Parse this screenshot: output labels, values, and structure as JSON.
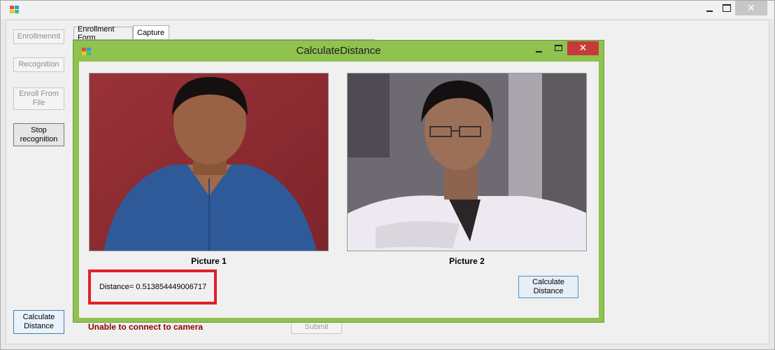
{
  "main_window": {
    "tabs": [
      {
        "label": "Enrollment Form",
        "active": false
      },
      {
        "label": "Capture",
        "active": true
      }
    ],
    "left_buttons": {
      "enrollment": "Enrollmenmt",
      "recognition": "Recognition",
      "enroll_from_file": "Enroll From File",
      "stop_recognition": "Stop recognition",
      "calculate_distance": "Calculate Distance"
    },
    "status_text": "Unable to connect to camera",
    "submit_label": "Submit",
    "close_glyph": "✕"
  },
  "dialog": {
    "title": "CalculateDistance",
    "close_glyph": "✕",
    "picture1_label": "Picture 1",
    "picture2_label": "Picture 2",
    "distance_text": "Distance= 0.513854449006717",
    "calculate_button": "Calculate Distance"
  },
  "colors": {
    "dialog_frame": "#8fc24f",
    "dialog_close": "#c73a3a",
    "highlight_box": "#e0202a",
    "status_text": "#8b0000"
  }
}
